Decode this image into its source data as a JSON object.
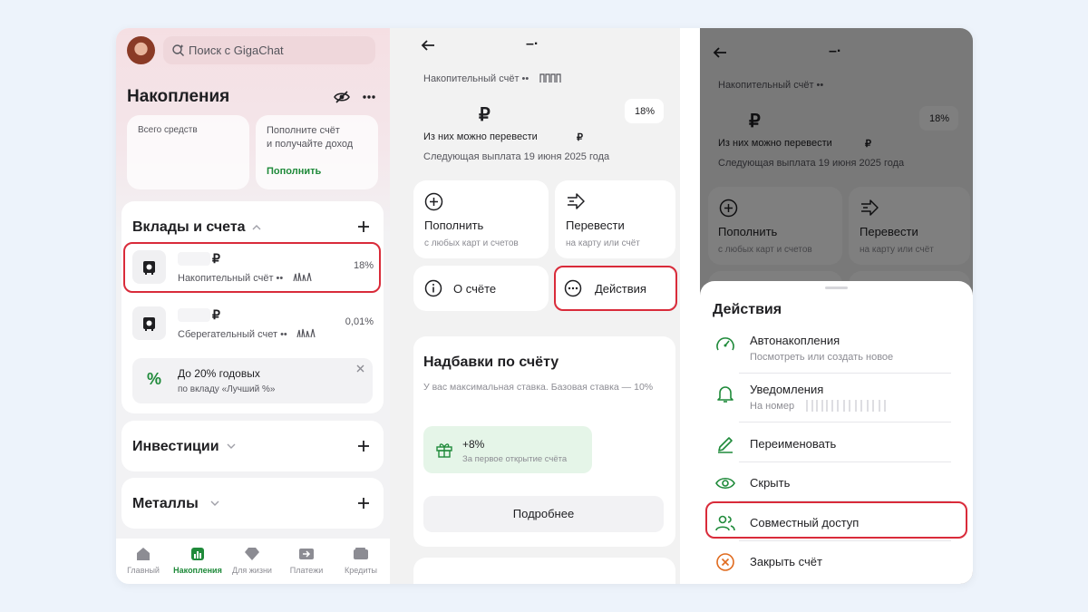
{
  "s1": {
    "search_placeholder": "Поиск с GigaChat",
    "title": "Накопления",
    "total_label": "Всего средств",
    "promo_text_1": "Пополните счёт",
    "promo_text_2": "и получайте доход",
    "promo_link": "Пополнить",
    "deposits_header": "Вклады и счета",
    "accounts": [
      {
        "currency": "₽",
        "name": "Накопительный счёт ••",
        "rate": "18%"
      },
      {
        "currency": "₽",
        "name": "Сберегательный счет ••",
        "rate": "0,01%"
      }
    ],
    "promo_banner_title": "До 20% годовых",
    "promo_banner_sub": "по вкладу «Лучший %»",
    "invest_header": "Инвестиции",
    "metals_header": "Металлы",
    "nav": [
      "Главный",
      "Накопления",
      "Для жизни",
      "Платежи",
      "Кредиты"
    ]
  },
  "s2": {
    "header_title": "–·",
    "account_label": "Накопительный счёт ••",
    "currency": "₽",
    "rate_badge": "18%",
    "transfer_label": "Из них можно перевести",
    "transfer_currency": "₽",
    "next_payout": "Следующая выплата 19 июня 2025 года",
    "topup_title": "Пополнить",
    "topup_sub": "с любых карт и счетов",
    "send_title": "Перевести",
    "send_sub": "на карту или счёт",
    "about": "О счёте",
    "actions": "Действия",
    "bonus_title": "Надбавки по счёту",
    "bonus_desc": "У вас максимальная ставка. Базовая ставка — 10%",
    "bonus_value": "+8%",
    "bonus_sub": "За первое открытие счёта",
    "more_button": "Подробнее"
  },
  "s3": {
    "sheet_title": "Действия",
    "items": [
      {
        "title": "Автонакопления",
        "sub": "Посмотреть или создать новое"
      },
      {
        "title": "Уведомления",
        "sub": "На номер"
      },
      {
        "title": "Переименовать",
        "sub": ""
      },
      {
        "title": "Скрыть",
        "sub": ""
      },
      {
        "title": "Совместный доступ",
        "sub": ""
      },
      {
        "title": "Закрыть счёт",
        "sub": ""
      }
    ]
  },
  "colors": {
    "accent": "#1f8a3a",
    "highlight": "#d92b3a",
    "danger": "#e06b1f"
  }
}
